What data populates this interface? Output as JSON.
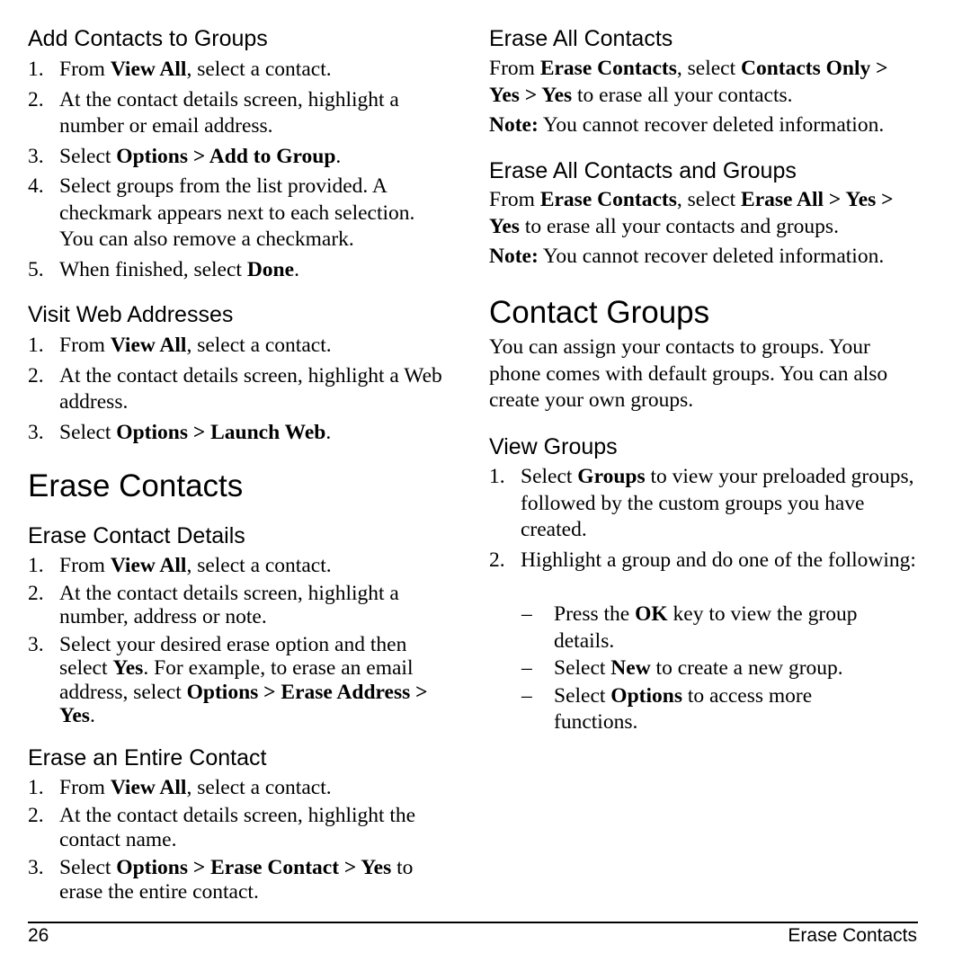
{
  "left_column": {
    "add_contacts_to_groups": {
      "heading": "Add Contacts to Groups",
      "steps": [
        {
          "num": "1.",
          "parts": [
            {
              "t": "From "
            },
            {
              "t": "View All",
              "b": true
            },
            {
              "t": ", select a contact."
            }
          ]
        },
        {
          "num": "2.",
          "parts": [
            {
              "t": "At the contact details screen, highlight a number or email address."
            }
          ]
        },
        {
          "num": "3.",
          "parts": [
            {
              "t": "Select "
            },
            {
              "t": "Options > Add to Group",
              "b": true
            },
            {
              "t": "."
            }
          ]
        },
        {
          "num": "4.",
          "parts": [
            {
              "t": "Select groups from the list provided. A checkmark appears next to each selection. You can also remove a checkmark."
            }
          ]
        },
        {
          "num": "5.",
          "parts": [
            {
              "t": "When finished, select "
            },
            {
              "t": "Done",
              "b": true
            },
            {
              "t": "."
            }
          ]
        }
      ]
    },
    "visit_web_addresses": {
      "heading": "Visit Web Addresses",
      "steps": [
        {
          "num": "1.",
          "parts": [
            {
              "t": "From "
            },
            {
              "t": "View All",
              "b": true
            },
            {
              "t": ", select a contact."
            }
          ]
        },
        {
          "num": "2.",
          "parts": [
            {
              "t": "At the contact details screen, highlight a Web address."
            }
          ]
        },
        {
          "num": "3.",
          "parts": [
            {
              "t": "Select "
            },
            {
              "t": "Options > Launch Web",
              "b": true
            },
            {
              "t": "."
            }
          ]
        }
      ]
    },
    "erase_contacts_title": "Erase Contacts",
    "erase_contact_details": {
      "heading": "Erase Contact Details",
      "steps": [
        {
          "num": "1.",
          "parts": [
            {
              "t": "From "
            },
            {
              "t": "View All",
              "b": true
            },
            {
              "t": ", select a contact."
            }
          ]
        },
        {
          "num": "2.",
          "parts": [
            {
              "t": "At the contact details screen, highlight a number, address or note."
            }
          ]
        },
        {
          "num": "3.",
          "parts": [
            {
              "t": "Select your desired erase option and then select "
            },
            {
              "t": "Yes",
              "b": true
            },
            {
              "t": ". For example, to erase an email address, select "
            },
            {
              "t": "Options > Erase Address > Yes",
              "b": true
            },
            {
              "t": "."
            }
          ]
        }
      ]
    },
    "erase_entire_contact": {
      "heading": "Erase an Entire Contact",
      "steps": [
        {
          "num": "1.",
          "parts": [
            {
              "t": "From "
            },
            {
              "t": "View All",
              "b": true
            },
            {
              "t": ", select a contact."
            }
          ]
        },
        {
          "num": "2.",
          "parts": [
            {
              "t": "At the contact details screen, highlight the contact name."
            }
          ]
        },
        {
          "num": "3.",
          "parts": [
            {
              "t": "Select "
            },
            {
              "t": "Options > Erase Contact > Yes",
              "b": true
            },
            {
              "t": " to erase the entire contact."
            }
          ]
        }
      ]
    }
  },
  "right_column": {
    "erase_all_contacts": {
      "heading": "Erase All Contacts",
      "para": [
        {
          "t": "From "
        },
        {
          "t": "Erase Contacts",
          "b": true
        },
        {
          "t": ", select "
        },
        {
          "t": "Contacts Only > Yes > Yes",
          "b": true
        },
        {
          "t": " to erase all your contacts."
        }
      ],
      "note": [
        {
          "t": "Note:",
          "b": true
        },
        {
          "t": " You cannot recover deleted information."
        }
      ]
    },
    "erase_all_contacts_groups": {
      "heading": "Erase All Contacts and Groups",
      "para": [
        {
          "t": "From "
        },
        {
          "t": "Erase Contacts",
          "b": true
        },
        {
          "t": ", select "
        },
        {
          "t": "Erase All > Yes > Yes",
          "b": true
        },
        {
          "t": " to erase all your contacts and groups."
        }
      ],
      "note": [
        {
          "t": "Note:",
          "b": true
        },
        {
          "t": " You cannot recover deleted information."
        }
      ]
    },
    "contact_groups_title": "Contact Groups",
    "contact_groups_intro": "You can assign your contacts to groups. Your phone comes with default groups. You can also create your own groups.",
    "view_groups": {
      "heading": "View Groups",
      "steps": [
        {
          "num": "1.",
          "parts": [
            {
              "t": "Select "
            },
            {
              "t": "Groups",
              "b": true
            },
            {
              "t": " to view your preloaded groups, followed by the custom groups you have created."
            }
          ]
        },
        {
          "num": "2.",
          "parts": [
            {
              "t": "Highlight a group and do one of the following:"
            }
          ]
        }
      ],
      "sub_items": [
        {
          "dash": "–",
          "parts": [
            {
              "t": "Press the "
            },
            {
              "t": "OK",
              "b": true
            },
            {
              "t": " key to view the group details."
            }
          ]
        },
        {
          "dash": "–",
          "parts": [
            {
              "t": "Select "
            },
            {
              "t": "New",
              "b": true
            },
            {
              "t": " to create a new group."
            }
          ]
        },
        {
          "dash": "–",
          "parts": [
            {
              "t": "Select "
            },
            {
              "t": "Options",
              "b": true
            },
            {
              "t": " to access more functions."
            }
          ]
        }
      ]
    }
  },
  "footer": {
    "page_number": "26",
    "section_name": "Erase Contacts"
  }
}
